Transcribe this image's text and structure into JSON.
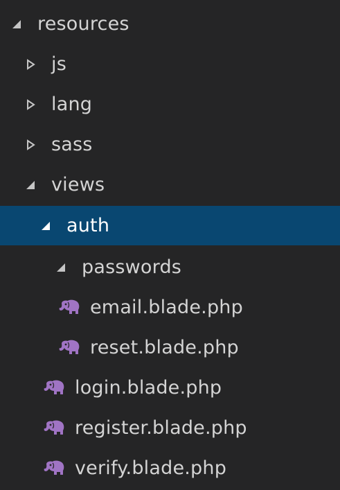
{
  "explorer": {
    "accent_color": "#094771",
    "icon_color": "#a074c4",
    "items": [
      {
        "label": "resources",
        "kind": "folder",
        "state": "expanded"
      },
      {
        "label": "js",
        "kind": "folder",
        "state": "collapsed"
      },
      {
        "label": "lang",
        "kind": "folder",
        "state": "collapsed"
      },
      {
        "label": "sass",
        "kind": "folder",
        "state": "collapsed"
      },
      {
        "label": "views",
        "kind": "folder",
        "state": "expanded"
      },
      {
        "label": "auth",
        "kind": "folder",
        "state": "expanded",
        "selected": true
      },
      {
        "label": "passwords",
        "kind": "folder",
        "state": "expanded"
      },
      {
        "label": "email.blade.php",
        "kind": "file",
        "icon": "php-elephant-icon"
      },
      {
        "label": "reset.blade.php",
        "kind": "file",
        "icon": "php-elephant-icon"
      },
      {
        "label": "login.blade.php",
        "kind": "file",
        "icon": "php-elephant-icon"
      },
      {
        "label": "register.blade.php",
        "kind": "file",
        "icon": "php-elephant-icon"
      },
      {
        "label": "verify.blade.php",
        "kind": "file",
        "icon": "php-elephant-icon"
      }
    ]
  }
}
